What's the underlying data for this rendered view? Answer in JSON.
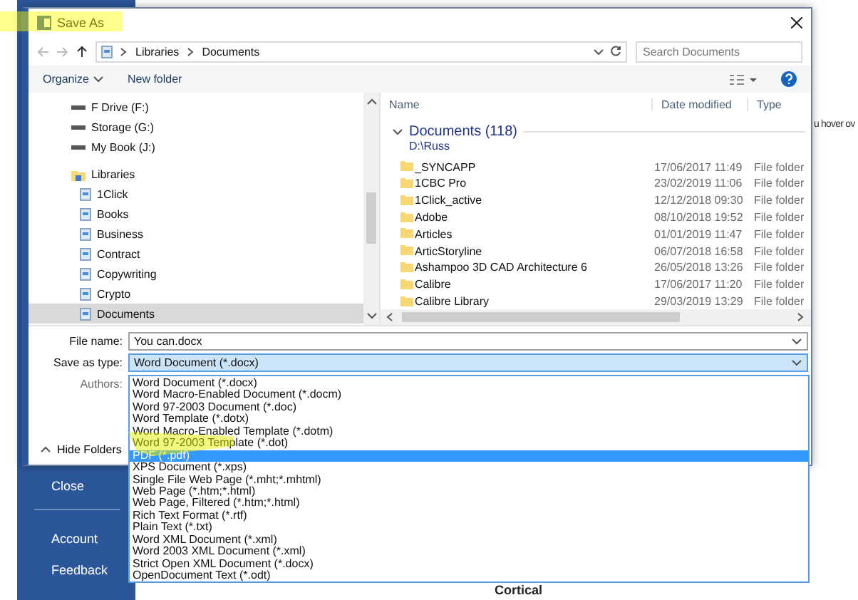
{
  "backstage": {
    "menu": [
      {
        "label": "Close"
      },
      {
        "label": "Account"
      },
      {
        "label": "Feedback"
      }
    ],
    "hint": "u hover ov",
    "heading": "Cortical"
  },
  "dialog": {
    "title": "Save As",
    "breadcrumb": [
      "Libraries",
      "Documents"
    ],
    "search": {
      "placeholder": "Search Documents"
    },
    "organize": "Organize",
    "new_folder": "New folder",
    "nav_items": [
      {
        "label": "F Drive (F:)",
        "kind": "drive",
        "selected": false
      },
      {
        "label": "Storage (G:)",
        "kind": "drive",
        "selected": false
      },
      {
        "label": "My Book (J:)",
        "kind": "drive",
        "selected": false
      },
      {
        "label": "Libraries",
        "kind": "group",
        "selected": false
      },
      {
        "label": "1Click",
        "kind": "library",
        "selected": false
      },
      {
        "label": "Books",
        "kind": "library",
        "selected": false
      },
      {
        "label": "Business",
        "kind": "library",
        "selected": false
      },
      {
        "label": "Contract",
        "kind": "library",
        "selected": false
      },
      {
        "label": "Copywriting",
        "kind": "library",
        "selected": false
      },
      {
        "label": "Crypto",
        "kind": "library",
        "selected": false
      },
      {
        "label": "Documents",
        "kind": "library",
        "selected": true
      }
    ],
    "columns": [
      "Name",
      "Date modified",
      "Type"
    ],
    "group": {
      "title": "Documents (118)",
      "path": "D:\\Russ"
    },
    "files": [
      {
        "name": "_SYNCAPP",
        "date": "17/06/2017 11:49",
        "type": "File folder"
      },
      {
        "name": "1CBC Pro",
        "date": "23/02/2019 11:06",
        "type": "File folder"
      },
      {
        "name": "1Click_active",
        "date": "12/12/2018 09:30",
        "type": "File folder"
      },
      {
        "name": "Adobe",
        "date": "08/10/2018 19:52",
        "type": "File folder"
      },
      {
        "name": "Articles",
        "date": "01/01/2019 11:47",
        "type": "File folder"
      },
      {
        "name": "ArticStoryline",
        "date": "06/07/2018 16:58",
        "type": "File folder"
      },
      {
        "name": "Ashampoo 3D CAD Architecture 6",
        "date": "26/05/2018 13:26",
        "type": "File folder"
      },
      {
        "name": "Calibre",
        "date": "17/06/2017 11:20",
        "type": "File folder"
      },
      {
        "name": "Calibre Library",
        "date": "29/03/2019 13:29",
        "type": "File folder"
      }
    ],
    "file_name": {
      "label": "File name:",
      "value": "You can.docx"
    },
    "save_type": {
      "label": "Save as type:",
      "value": "Word Document (*.docx)"
    },
    "authors_label": "Authors:",
    "hide_folders": "Hide Folders"
  },
  "type_list": [
    {
      "label": "Word Document (*.docx)",
      "selected": false
    },
    {
      "label": "Word Macro-Enabled Document (*.docm)",
      "selected": false
    },
    {
      "label": "Word 97-2003 Document (*.doc)",
      "selected": false
    },
    {
      "label": "Word Template (*.dotx)",
      "selected": false
    },
    {
      "label": "Word Macro-Enabled Template (*.dotm)",
      "selected": false
    },
    {
      "label": "Word 97-2003 Template (*.dot)",
      "selected": false
    },
    {
      "label": "PDF (*.pdf)",
      "selected": true
    },
    {
      "label": "XPS Document (*.xps)",
      "selected": false
    },
    {
      "label": "Single File Web Page (*.mht;*.mhtml)",
      "selected": false
    },
    {
      "label": "Web Page (*.htm;*.html)",
      "selected": false
    },
    {
      "label": "Web Page, Filtered (*.htm;*.html)",
      "selected": false
    },
    {
      "label": "Rich Text Format (*.rtf)",
      "selected": false
    },
    {
      "label": "Plain Text (*.txt)",
      "selected": false
    },
    {
      "label": "Word XML Document (*.xml)",
      "selected": false
    },
    {
      "label": "Word 2003 XML Document (*.xml)",
      "selected": false
    },
    {
      "label": "Strict Open XML Document (*.docx)",
      "selected": false
    },
    {
      "label": "OpenDocument Text (*.odt)",
      "selected": false
    }
  ]
}
